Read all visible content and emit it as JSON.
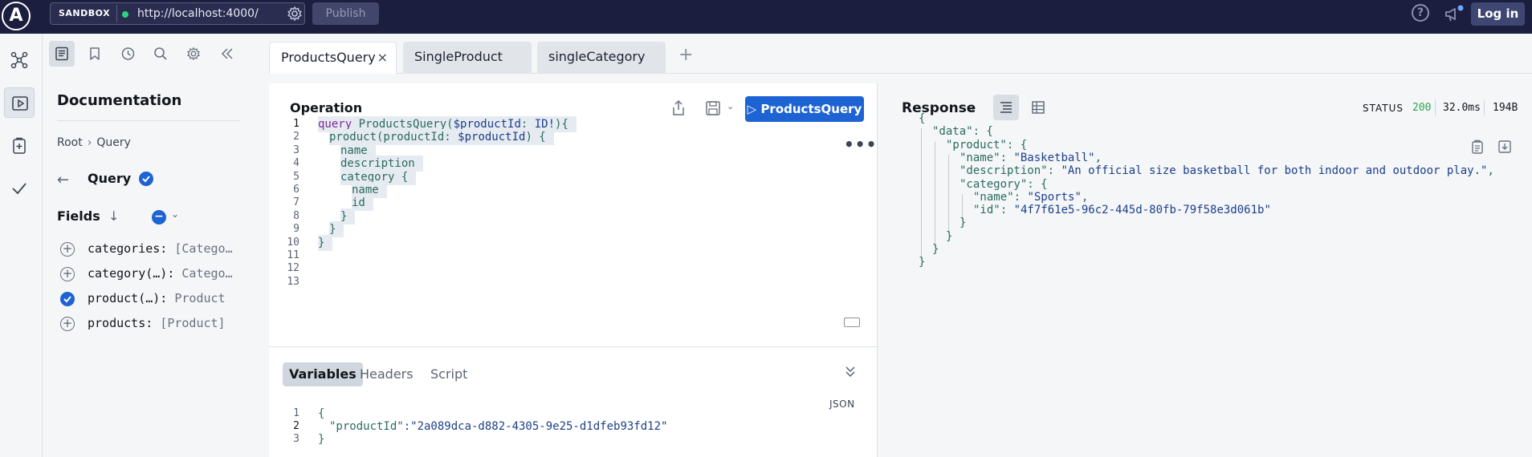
{
  "topbar": {
    "logo_letter": "A",
    "sandbox_label": "SANDBOX",
    "url": "http://localhost:4000/",
    "publish_label": "Publish",
    "help_glyph": "?",
    "login_label": "Log in",
    "icons": [
      "apollo-logo-icon",
      "gear-icon",
      "help-icon",
      "megaphone-icon"
    ]
  },
  "rail": {
    "items": [
      {
        "name": "schema-graph-icon"
      },
      {
        "name": "explorer-play-icon",
        "active": true
      },
      {
        "name": "checks-clipboard-icon"
      },
      {
        "name": "checkmark-icon"
      }
    ]
  },
  "docs": {
    "title": "Documentation",
    "breadcrumb": [
      "Root",
      "Query"
    ],
    "back_glyph": "←",
    "current_type": "Query",
    "fields_label": "Fields",
    "sort_glyph": "↓",
    "minus_glyph": "−",
    "chev_glyph": "⌄",
    "fields": [
      {
        "name": "categories: ",
        "type": "[Catego…",
        "selected": false
      },
      {
        "name": "category(…): ",
        "type": "Catego…",
        "selected": false
      },
      {
        "name": "product(…): ",
        "type": "Product",
        "selected": true
      },
      {
        "name": "products: ",
        "type": "[Product]",
        "selected": false
      }
    ],
    "toolbar_icons": [
      "docs-icon",
      "bookmark-icon",
      "history-icon",
      "search-icon",
      "gear-icon",
      "collapse-icon"
    ]
  },
  "tabs": {
    "items": [
      {
        "label": "ProductsQuery",
        "active": true
      },
      {
        "label": "SingleProduct",
        "active": false
      },
      {
        "label": "singleCategory",
        "active": false
      }
    ],
    "close_glyph": "×",
    "add_glyph": "+"
  },
  "operation": {
    "title": "Operation",
    "run_label": "ProductsQuery",
    "run_glyph": "▷",
    "more_glyph": "•••",
    "lines": [
      {
        "n": "1",
        "text": "query ProductsQuery($productId: ID!){",
        "indent": 0
      },
      {
        "n": "2",
        "text": "product(productId: $productId) {",
        "indent": 1
      },
      {
        "n": "3",
        "text": "name",
        "indent": 2
      },
      {
        "n": "4",
        "text": "description",
        "indent": 2
      },
      {
        "n": "5",
        "text": "category {",
        "indent": 2
      },
      {
        "n": "6",
        "text": "name",
        "indent": 3
      },
      {
        "n": "7",
        "text": "id",
        "indent": 3
      },
      {
        "n": "8",
        "text": "}",
        "indent": 2
      },
      {
        "n": "9",
        "text": "}",
        "indent": 1
      },
      {
        "n": "10",
        "text": "}",
        "indent": 0
      },
      {
        "n": "11",
        "text": "",
        "indent": 0
      },
      {
        "n": "12",
        "text": "",
        "indent": 0
      },
      {
        "n": "13",
        "text": "",
        "indent": 0
      }
    ]
  },
  "variables": {
    "tabs": [
      "Variables",
      "Headers",
      "Script"
    ],
    "collapse_glyph": "⌄⌄",
    "format_label": "JSON",
    "lines": [
      {
        "n": "1",
        "text": "{"
      },
      {
        "n": "2",
        "key": "\"productId\"",
        "value": ":\"2a089dca-d882-4305-9e25-d1dfeb93fd12\""
      },
      {
        "n": "3",
        "text": "}"
      }
    ]
  },
  "response": {
    "title": "Response",
    "chev_glyph": "⌄",
    "status_label": "STATUS",
    "status_code": "200",
    "time": "32.0ms",
    "size": "194B",
    "lines": [
      {
        "text": "{",
        "indent": 0
      },
      {
        "key": "\"data\"",
        "rest": ": {",
        "indent": 1
      },
      {
        "key": "\"product\"",
        "rest": ": {",
        "indent": 2
      },
      {
        "key": "\"name\"",
        "rest": ": ",
        "str": "\"Basketball\"",
        "tail": ",",
        "indent": 3
      },
      {
        "key": "\"description\"",
        "rest": ": ",
        "str": "\"An official size basketball for both indoor and outdoor play.\"",
        "tail": ",",
        "indent": 3
      },
      {
        "key": "\"category\"",
        "rest": ": {",
        "indent": 3
      },
      {
        "key": "\"name\"",
        "rest": ": ",
        "str": "\"Sports\"",
        "tail": ",",
        "indent": 4
      },
      {
        "key": "\"id\"",
        "rest": ": ",
        "str": "\"4f7f61e5-96c2-445d-80fb-79f58e3d061b\"",
        "tail": "",
        "indent": 4
      },
      {
        "text": "}",
        "indent": 3
      },
      {
        "text": "}",
        "indent": 2
      },
      {
        "text": "}",
        "indent": 1
      },
      {
        "text": "}",
        "indent": 0
      }
    ]
  },
  "colors": {
    "topbar_bg": "#1c1e3f",
    "primary": "#1d63d3",
    "status_ok": "#2da44e"
  }
}
